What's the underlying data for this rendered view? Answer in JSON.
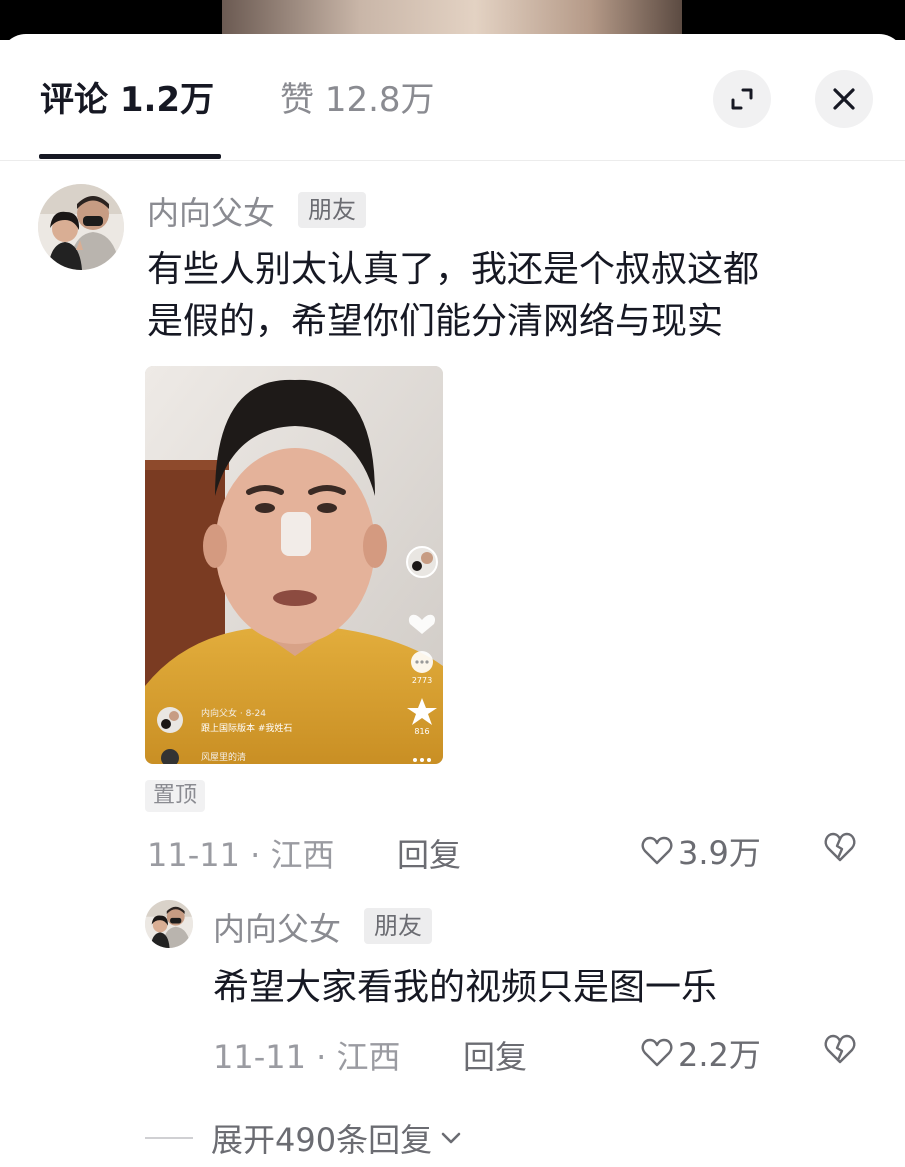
{
  "header": {
    "comments_label": "评论",
    "comments_count": "1.2万",
    "likes_label": "赞",
    "likes_count": "12.8万"
  },
  "comments": [
    {
      "author": "内向父女",
      "badge": "朋友",
      "text_line1": "有些人别太认真了，我还是个叔叔这都",
      "text_line2": "是假的，希望你们能分清网络与现实",
      "pinned": "置顶",
      "date": "11-11",
      "location": "江西",
      "reply_label": "回复",
      "likes": "3.9万",
      "video_card": {
        "author": "内向父女 · 8-24",
        "caption": "跟上国际版本 #我姓石",
        "comment_preview": "风屋里的清",
        "comment_count": "2773",
        "star_count": "816"
      }
    },
    {
      "author": "内向父女",
      "badge": "朋友",
      "text": "希望大家看我的视频只是图一乐",
      "date": "11-11",
      "location": "江西",
      "reply_label": "回复",
      "likes": "2.2万"
    }
  ],
  "expand_replies": "展开490条回复",
  "icons": [
    "expand-icon",
    "close-icon",
    "heart-icon",
    "dislike-heart-icon",
    "chevron-down-icon"
  ]
}
